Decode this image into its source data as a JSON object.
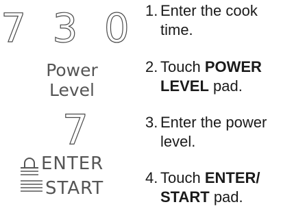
{
  "display": {
    "cook_time_digits": "7 3 0",
    "power_level_key": [
      "Power",
      "Level"
    ],
    "power_level_digit": "7",
    "enter_start_key": [
      "ENTER",
      "START"
    ]
  },
  "steps": [
    {
      "number": "1.",
      "line1": "Enter the cook",
      "line2": "time."
    },
    {
      "number": "2.",
      "line1_pre": "Touch ",
      "line1_bold": "POWER",
      "line2_bold": "LEVEL",
      "line2_post": " pad."
    },
    {
      "number": "3.",
      "line1": "Enter the power",
      "line2": "level."
    },
    {
      "number": "4.",
      "line1_pre": "Touch ",
      "line1_bold": "ENTER/",
      "line2_bold": "START",
      "line2_post": " pad."
    }
  ]
}
